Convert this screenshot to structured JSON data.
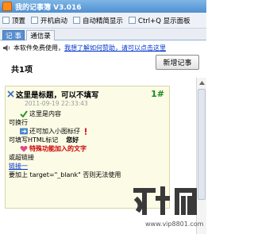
{
  "window": {
    "title": "我的记事簿 V3.016"
  },
  "options": [
    {
      "label": "顶置"
    },
    {
      "label": "开机启动"
    },
    {
      "label": "自动精简显示"
    },
    {
      "label": "Ctrl+Q 显示面板"
    }
  ],
  "tabs": [
    {
      "label": "记 事",
      "active": true
    },
    {
      "label": "通信录",
      "active": false
    }
  ],
  "notice": {
    "text": "本软件免费使用，",
    "link": "我想了解如何赞助，请可以点击这里"
  },
  "count_label": "共1项",
  "new_button": "新增记事",
  "note": {
    "title": "这里是标题，可以不填写",
    "number": "1#",
    "date": "2011-09-19 22:33:43",
    "lines": {
      "l1": "这里是内容",
      "l2": "可换行",
      "l3": "还可加入小图标仔",
      "l4a": "可填写HTML标记",
      "l4b": "您好",
      "l5": "特殊功能加入的文字",
      "l6": "或超链接",
      "l7": "链接一",
      "l8": "要加上  target=\"_blank\"  否则无法使用"
    }
  },
  "watermark": {
    "url": "www.vip8801.com"
  },
  "colors": {
    "title_gradient_top": "#7fb6e6",
    "title_gradient_bottom": "#4f8fd0",
    "active_tab": "#5a8fd0",
    "note_bg": "#fbfbe6",
    "note_number": "#1a8a1a",
    "link": "#0033cc",
    "special_text": "#cc0000"
  }
}
